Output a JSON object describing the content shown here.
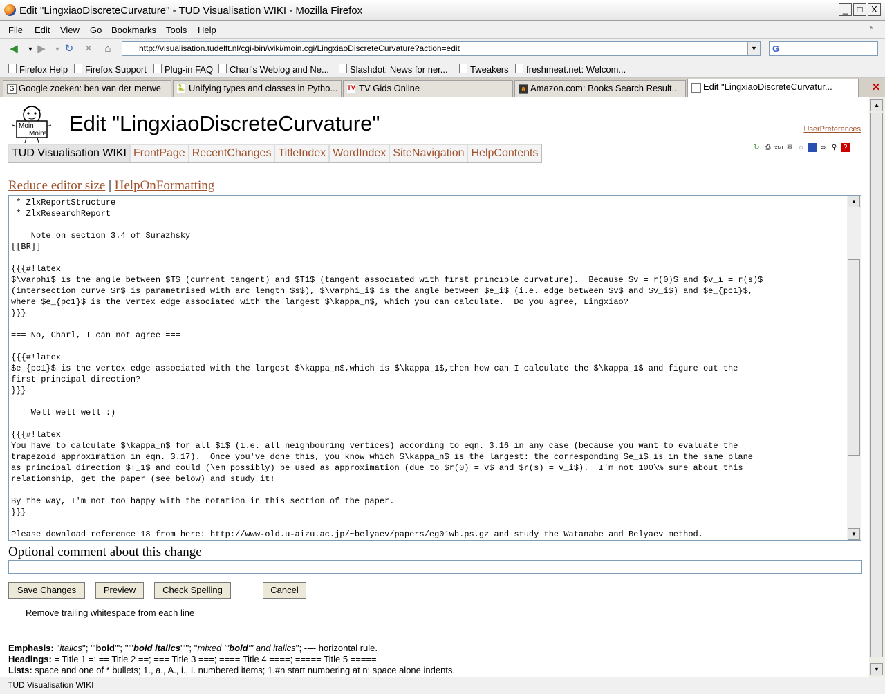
{
  "window": {
    "title": "Edit \"LingxiaoDiscreteCurvature\" - TUD Visualisation WIKI - Mozilla Firefox",
    "buttons": [
      "_",
      "□",
      "X"
    ]
  },
  "menu": [
    "File",
    "Edit",
    "View",
    "Go",
    "Bookmarks",
    "Tools",
    "Help"
  ],
  "nav": {
    "url": "http://visualisation.tudelft.nl/cgi-bin/wiki/moin.cgi/LingxiaoDiscreteCurvature?action=edit",
    "search_glyph": "G"
  },
  "bookmarks": [
    "Firefox Help",
    "Firefox Support",
    "Plug-in FAQ",
    "Charl's Weblog and Ne...",
    "Slashdot: News for ner...",
    "Tweakers",
    "freshmeat.net: Welcom..."
  ],
  "tabs": [
    {
      "label": "Google zoeken: ben van der merwe",
      "glyph": "G"
    },
    {
      "label": "Unifying types and classes in Pytho...",
      "glyph": "🐍"
    },
    {
      "label": "TV Gids Online",
      "glyph": "TV"
    },
    {
      "label": "Amazon.com: Books Search Result...",
      "glyph": "a"
    },
    {
      "label": "Edit \"LingxiaoDiscreteCurvatur...",
      "glyph": ""
    }
  ],
  "page": {
    "logo_text": "Moin Moin!",
    "title": "Edit \"LingxiaoDiscreteCurvature\"",
    "user_preferences": "UserPreferences",
    "site_name": "TUD Visualisation WIKI",
    "nav_links": [
      "FrontPage",
      "RecentChanges",
      "TitleIndex",
      "WordIndex",
      "SiteNavigation",
      "HelpContents"
    ],
    "edit_links": {
      "reduce": "Reduce editor size",
      "sep": "|",
      "help": "HelpOnFormatting"
    },
    "editor_text": " * ZlxReportStructure\n * ZlxResearchReport\n\n=== Note on section 3.4 of Surazhsky ===\n[[BR]]\n\n{{{#!latex\n$\\varphi$ is the angle between $T$ (current tangent) and $T1$ (tangent associated with first principle curvature).  Because $v = r(0)$ and $v_i = r(s)$\n(intersection curve $r$ is parametrised with arc length $s$), $\\varphi_i$ is the angle between $e_i$ (i.e. edge between $v$ and $v_i$) and $e_{pc1}$,\nwhere $e_{pc1}$ is the vertex edge associated with the largest $\\kappa_n$, which you can calculate.  Do you agree, Lingxiao?\n}}}\n\n=== No, Charl, I can not agree ===\n\n{{{#!latex\n$e_{pc1}$ is the vertex edge associated with the largest $\\kappa_n$,which is $\\kappa_1$,then how can I calculate the $\\kappa_1$ and figure out the\nfirst principal direction?\n}}}\n\n=== Well well well :) ===\n\n{{{#!latex\nYou have to calculate $\\kappa_n$ for all $i$ (i.e. all neighbouring vertices) according to eqn. 3.16 in any case (because you want to evaluate the\ntrapezoid approximation in eqn. 3.17).  Once you've done this, you know which $\\kappa_n$ is the largest: the corresponding $e_i$ is in the same plane\nas principal direction $T_1$ and could (\\em possibly) be used as approximation (due to $r(0) = v$ and $r(s) = v_i$).  I'm not 100\\% sure about this\nrelationship, get the paper (see below) and study it!\n\nBy the way, I'm not too happy with the notation in this section of the paper.\n}}}\n\nPlease download reference 18 from here: http://www-old.u-aizu.ac.jp/~belyaev/papers/eg01wb.ps.gz and study the Watanabe and Belyaev method.",
    "comment_label": "Optional comment about this change",
    "comment_value": "",
    "buttons": {
      "save": "Save Changes",
      "preview": "Preview",
      "spell": "Check Spelling",
      "cancel": "Cancel"
    },
    "trailing_ws_label": "Remove trailing whitespace from each line",
    "trailing_ws_checked": false,
    "help": {
      "emphasis_key": "Emphasis:",
      "emphasis_parts": [
        "''",
        "italics",
        "''; '''",
        "bold",
        "'''; '''''",
        "bold italics",
        "'''''; ''",
        "mixed '''",
        "bold",
        "''' and italics",
        "''; ---- horizontal rule."
      ],
      "headings_key": "Headings:",
      "headings_text": " = Title 1 =; == Title 2 ==; === Title 3 ===; ==== Title 4 ====; ===== Title 5 =====.",
      "lists_key": "Lists:",
      "lists_text": " space and one of * bullets; 1., a., A., i., I. numbered items; 1.#n start numbering at n; space alone indents."
    }
  },
  "status_text": "TUD Visualisation WIKI"
}
